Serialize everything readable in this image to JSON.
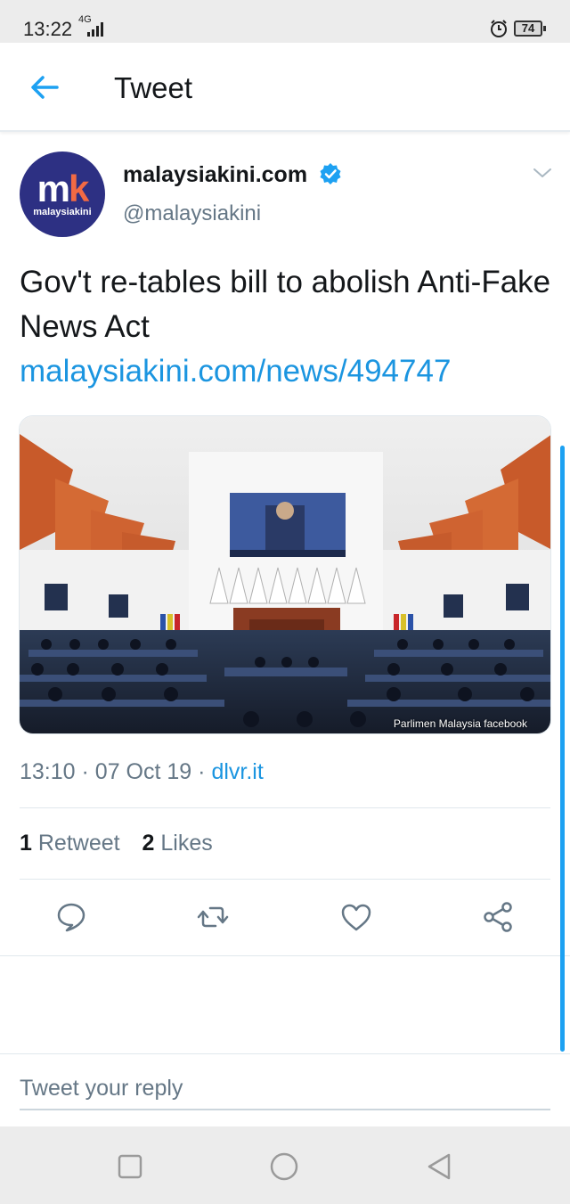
{
  "status_bar": {
    "time": "13:22",
    "network": "4G",
    "battery": "74",
    "icons": [
      "signal-icon",
      "alarm-icon",
      "battery-icon"
    ]
  },
  "header": {
    "title": "Tweet",
    "back_icon": "arrow-left-icon"
  },
  "tweet": {
    "avatar_logo_text": "mk",
    "avatar_sub_text": "malaysiakini",
    "display_name": "malaysiakini.com",
    "verified": true,
    "handle": "@malaysiakini",
    "text": "Gov't re-tables bill to abolish Anti-Fake News Act ",
    "link_text": "malaysiakini.com/news/494747",
    "media": {
      "credit": "Parlimen Malaysia facebook",
      "screen_caption": "Parliament screen"
    },
    "time": "13:10",
    "date": "07 Oct 19",
    "source": "dlvr.it",
    "retweet_count": "1",
    "retweet_label": "Retweet",
    "like_count": "2",
    "like_label": "Likes"
  },
  "actions": [
    {
      "name": "reply-icon"
    },
    {
      "name": "retweet-icon"
    },
    {
      "name": "like-icon"
    },
    {
      "name": "share-icon"
    }
  ],
  "reply": {
    "placeholder": "Tweet your reply"
  },
  "colors": {
    "accent": "#1da1f2",
    "link": "#1b95e0",
    "secondary_text": "#657786",
    "brand_avatar": "#2d3083",
    "brand_orange": "#f26a44"
  },
  "nav_bar": {
    "buttons": [
      "recent-apps-icon",
      "home-icon",
      "back-triangle-icon"
    ]
  }
}
